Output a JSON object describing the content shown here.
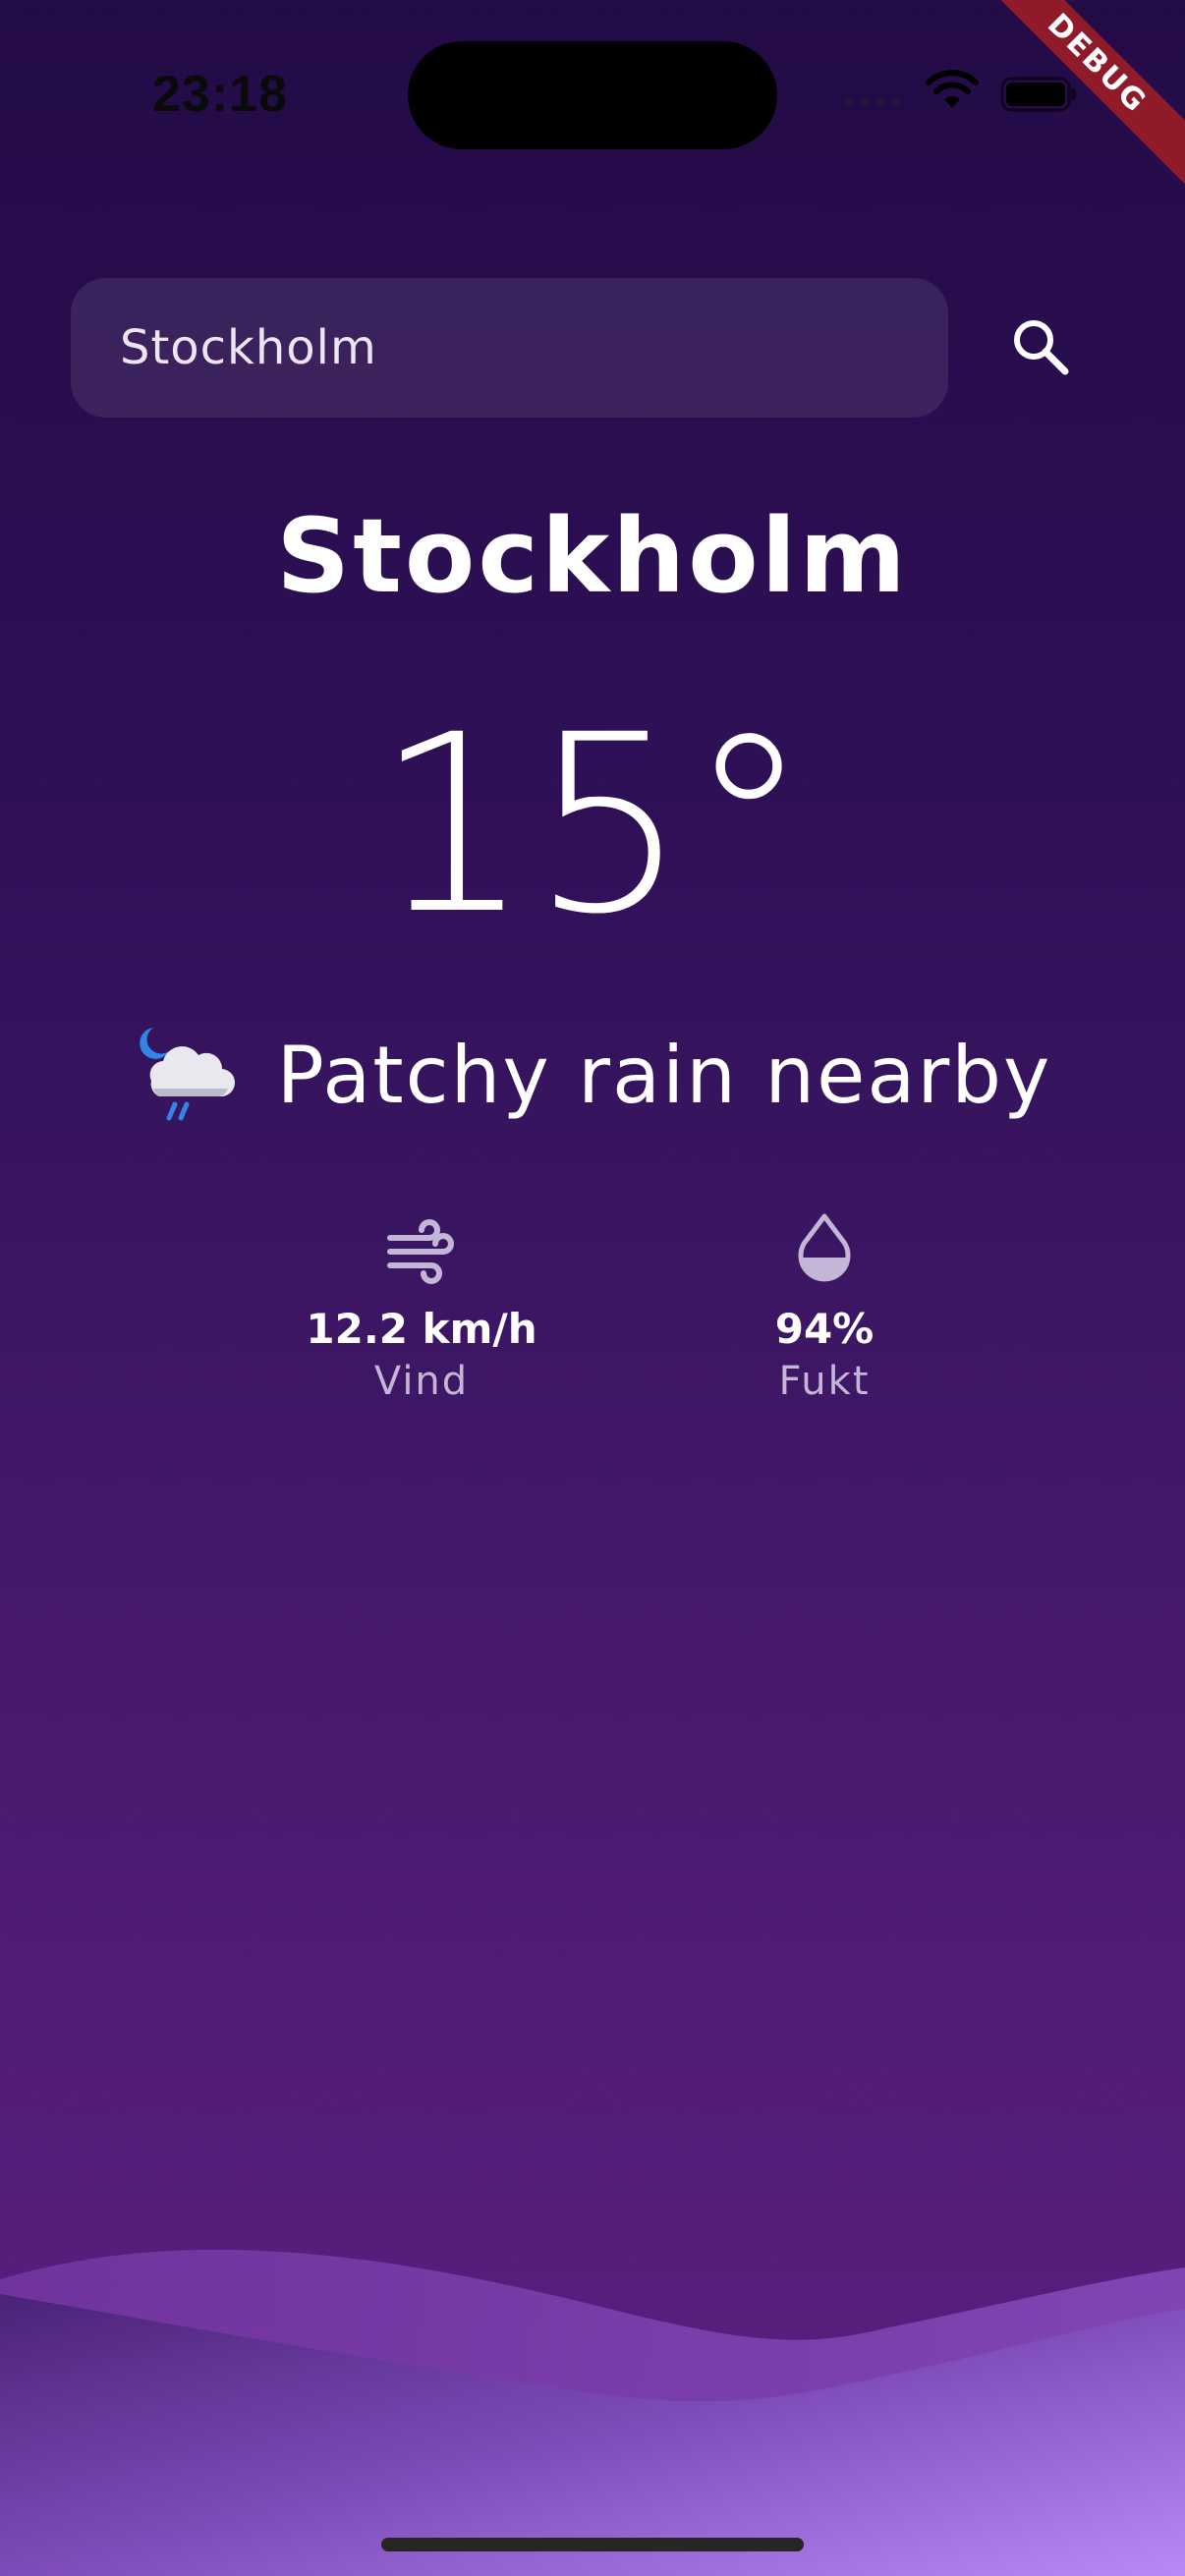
{
  "status_bar": {
    "time": "23:18"
  },
  "debug_banner": "DEBUG",
  "search": {
    "value": "Stockholm",
    "placeholder": ""
  },
  "weather": {
    "city": "Stockholm",
    "temperature": "15°",
    "condition": "Patchy rain nearby",
    "condition_icon": "moon-cloud-rain-icon"
  },
  "stats": {
    "wind": {
      "icon": "wind-icon",
      "value": "12.2 km/h",
      "label": "Vind"
    },
    "humidity": {
      "icon": "water-drop-icon",
      "value": "94%",
      "label": "Fukt"
    }
  },
  "colors": {
    "background_top": "#230b46",
    "background_bottom": "#5b1f80",
    "wave_light": "#a47bf0",
    "debug_banner": "#8e1a2a"
  }
}
